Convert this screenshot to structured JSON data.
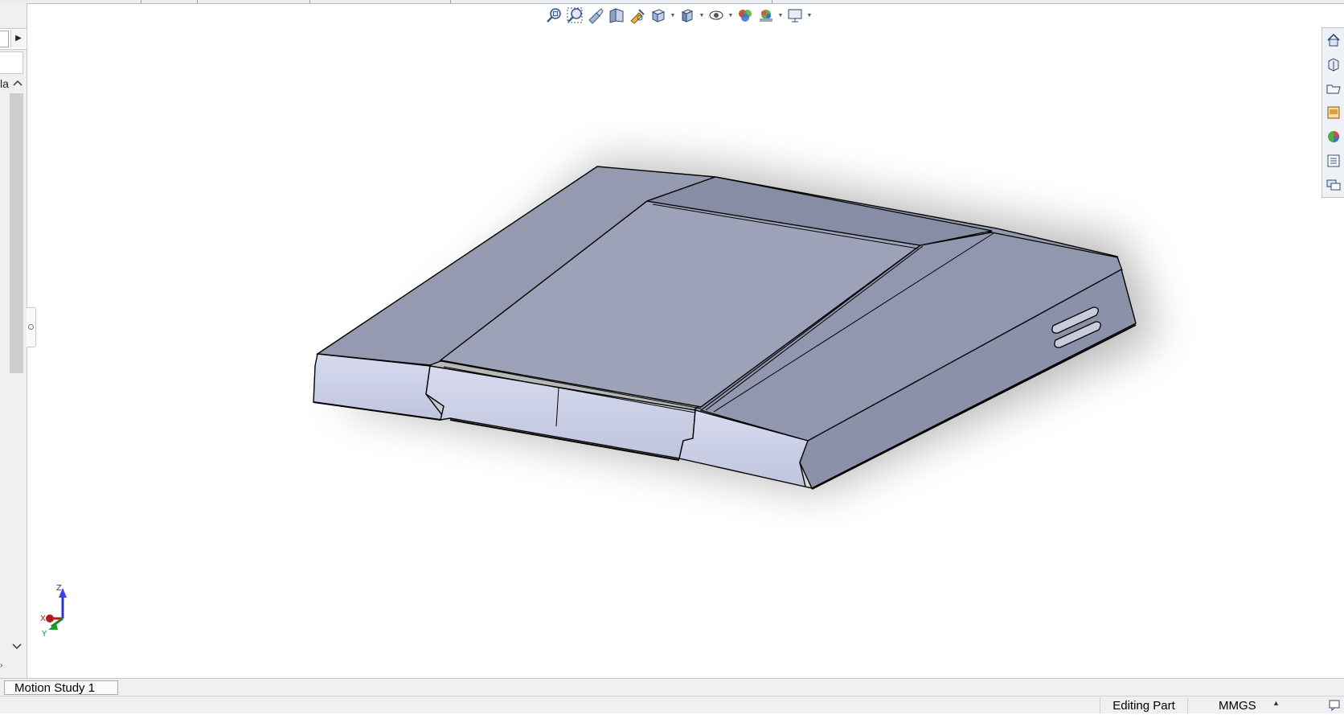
{
  "left_panel": {
    "partial_label": "la",
    "arrow_right_icon": "right-arrow-icon",
    "scroll_up_icon": "chevron-up-icon",
    "scroll_down_icon": "chevron-down-icon"
  },
  "heads_up_toolbar": {
    "icons": [
      "zoom-to-fit-icon",
      "zoom-to-area-icon",
      "previous-view-icon",
      "section-view-icon",
      "dynamic-annotation-views-icon",
      "view-orientation-icon",
      "display-style-icon",
      "hide-show-items-icon",
      "edit-appearance-icon",
      "apply-scene-icon",
      "view-settings-icon"
    ]
  },
  "task_pane": {
    "tabs": [
      "home-icon",
      "design-library-icon",
      "file-explorer-icon",
      "view-palette-icon",
      "appearances-icon",
      "custom-properties-icon",
      "forum-icon"
    ]
  },
  "triad": {
    "z": "Z",
    "x": "X",
    "y": "Y"
  },
  "bottom_tabs": {
    "motion_study": "Motion Study 1"
  },
  "status_bar": {
    "editing": "Editing Part",
    "units": "MMGS"
  },
  "colors": {
    "model_face": "#9ba0b6",
    "model_edge": "#000000",
    "panel_bg": "#f0f0f0"
  }
}
